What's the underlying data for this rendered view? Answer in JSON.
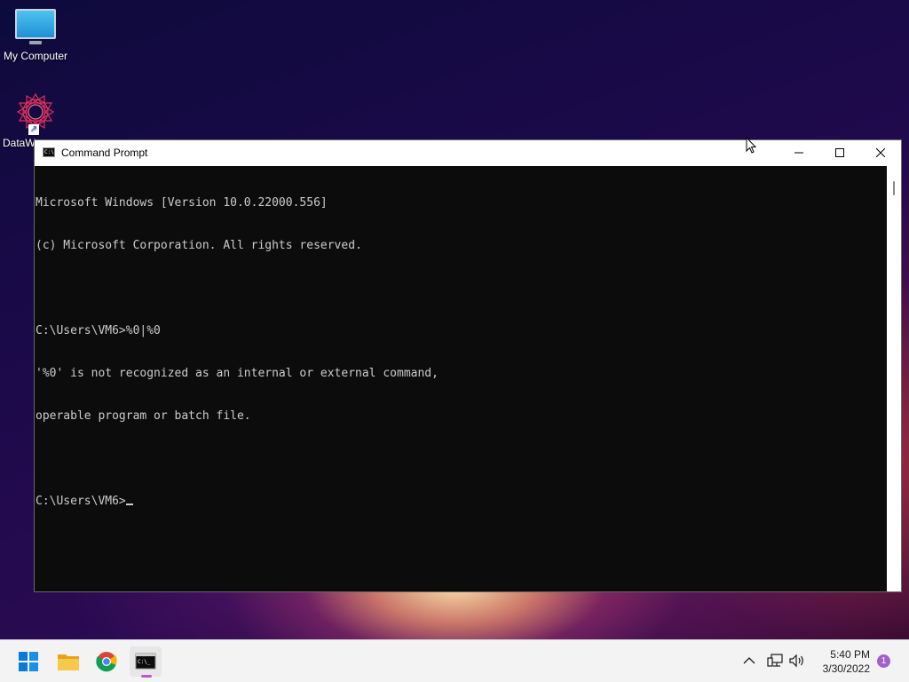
{
  "desktop": {
    "icons": [
      {
        "label": "My Computer",
        "icon": "monitor-icon"
      },
      {
        "label": "DataW",
        "icon": "mandala-app-icon"
      }
    ]
  },
  "window": {
    "title": "Command Prompt",
    "icon": "cmd-icon",
    "controls": [
      "minimize-icon",
      "maximize-icon",
      "close-icon"
    ]
  },
  "console": {
    "lines": [
      "Microsoft Windows [Version 10.0.22000.556]",
      "(c) Microsoft Corporation. All rights reserved.",
      "",
      "C:\\Users\\VM6>%0|%0",
      "'%0' is not recognized as an internal or external command,",
      "operable program or batch file.",
      "",
      "C:\\Users\\VM6>"
    ],
    "text_color": "#cccccc",
    "background": "#0c0c0c"
  },
  "taskbar": {
    "apps": [
      "windows-start-icon",
      "file-explorer-icon",
      "chrome-icon",
      "command-prompt-icon"
    ],
    "active_app": "command-prompt-icon",
    "tray_icons": [
      "chevron-up-icon",
      "network-icon",
      "volume-icon"
    ],
    "clock": {
      "time": "5:40 PM",
      "date": "3/30/2022"
    },
    "notification_count": "1",
    "accent_color": "#b65cc9"
  }
}
